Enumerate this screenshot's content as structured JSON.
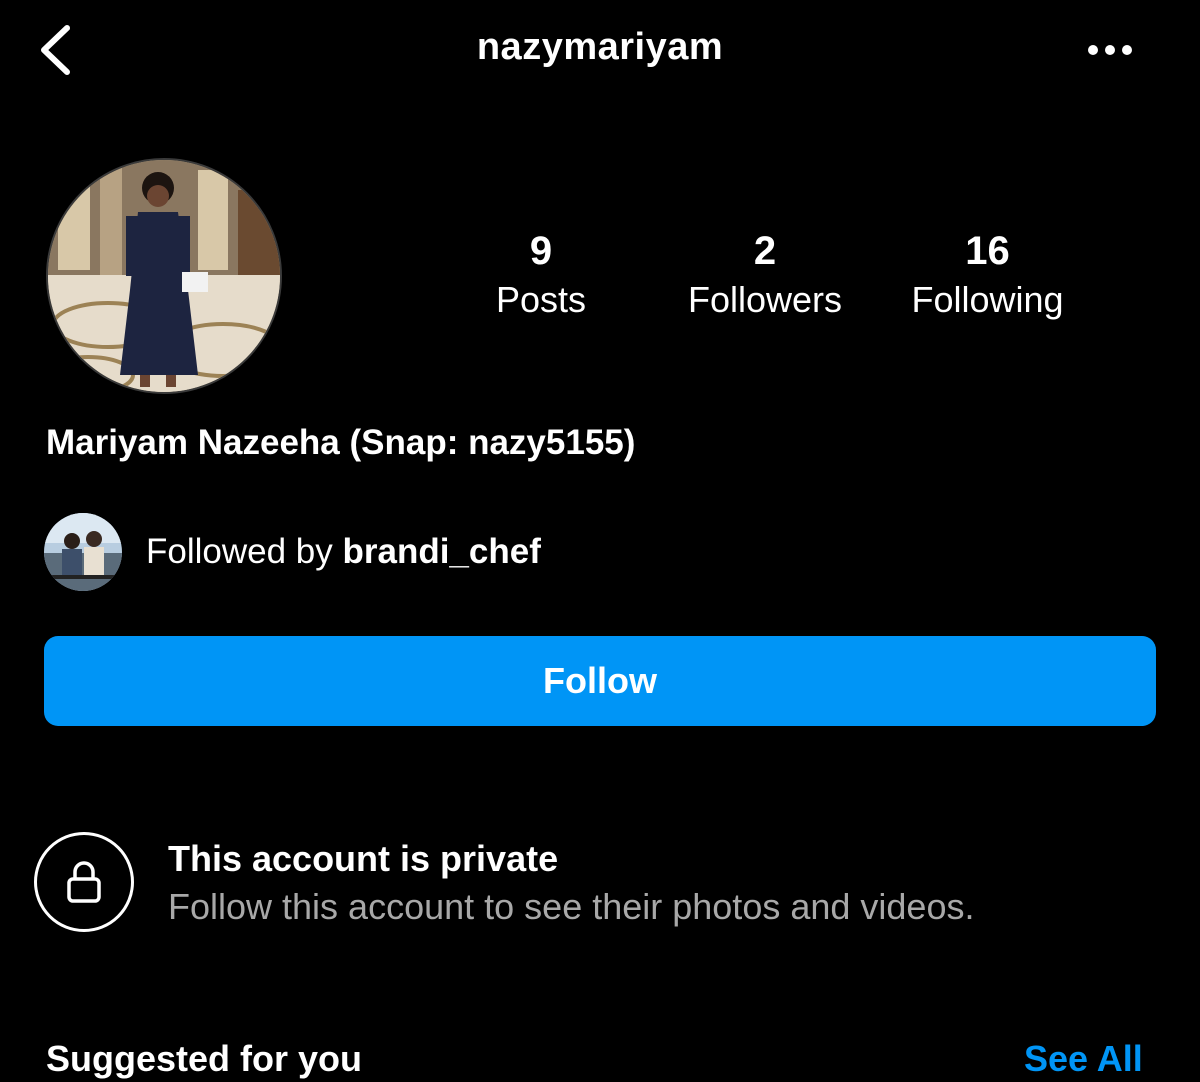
{
  "header": {
    "username": "nazymariyam",
    "back_icon": "chevron-left-icon",
    "more_icon": "more-horizontal-icon"
  },
  "profile": {
    "display_name": "Mariyam Nazeeha (Snap: nazy5155)",
    "stats": {
      "posts": {
        "count": "9",
        "label": "Posts"
      },
      "followers": {
        "count": "2",
        "label": "Followers"
      },
      "following": {
        "count": "16",
        "label": "Following"
      }
    },
    "followed_by": {
      "prefix": "Followed by ",
      "username": "brandi_chef"
    }
  },
  "actions": {
    "follow_label": "Follow"
  },
  "private_notice": {
    "title": "This account is private",
    "subtitle": "Follow this account to see their photos and videos.",
    "icon": "lock-icon"
  },
  "suggested": {
    "label": "Suggested for you",
    "see_all_label": "See All"
  },
  "colors": {
    "background": "#000000",
    "accent": "#0095f6",
    "secondary_text": "#a8a8a8"
  }
}
